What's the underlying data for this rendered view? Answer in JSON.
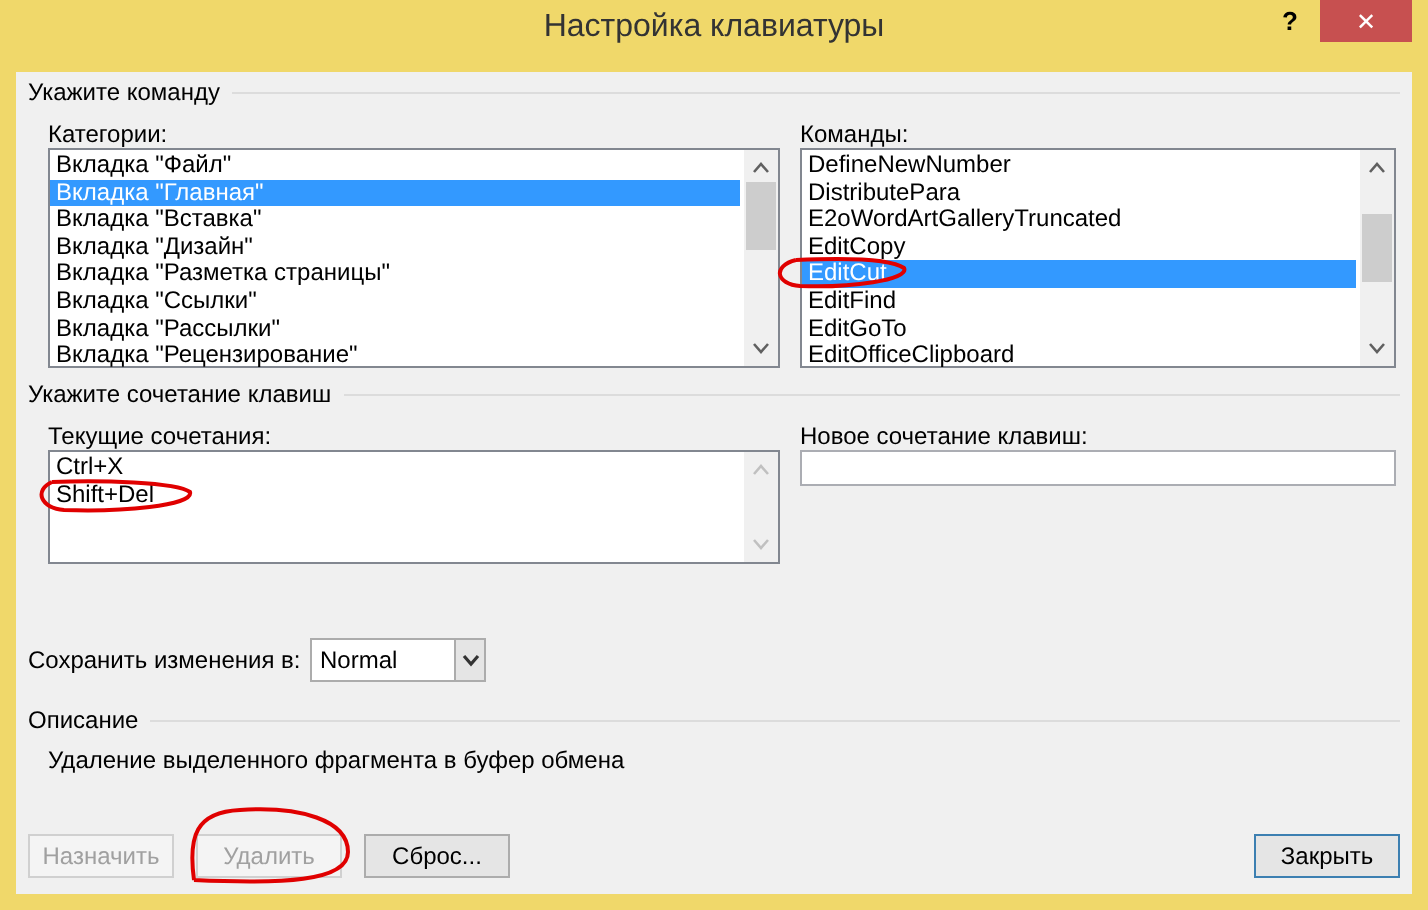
{
  "window": {
    "title": "Настройка клавиатуры",
    "help": "?",
    "close": "✕"
  },
  "command_group": {
    "title": "Укажите команду",
    "categories": {
      "label": "Категории:",
      "items": [
        {
          "text": "Вкладка \"Файл\"",
          "selected": false
        },
        {
          "text": "Вкладка \"Главная\"",
          "selected": true
        },
        {
          "text": "Вкладка \"Вставка\"",
          "selected": false
        },
        {
          "text": "Вкладка \"Дизайн\"",
          "selected": false
        },
        {
          "text": "Вкладка \"Разметка страницы\"",
          "selected": false
        },
        {
          "text": "Вкладка \"Ссылки\"",
          "selected": false
        },
        {
          "text": "Вкладка \"Рассылки\"",
          "selected": false
        },
        {
          "text": "Вкладка \"Рецензирование\"",
          "selected": false
        }
      ]
    },
    "commands": {
      "label": "Команды:",
      "items": [
        {
          "text": "DefineNewNumber",
          "selected": false
        },
        {
          "text": "DistributePara",
          "selected": false
        },
        {
          "text": "E2oWordArtGalleryTruncated",
          "selected": false
        },
        {
          "text": "EditCopy",
          "selected": false
        },
        {
          "text": "EditCut",
          "selected": true
        },
        {
          "text": "EditFind",
          "selected": false
        },
        {
          "text": "EditGoTo",
          "selected": false
        },
        {
          "text": "EditOfficeClipboard",
          "selected": false
        }
      ]
    }
  },
  "shortcut_group": {
    "title": "Укажите сочетание клавиш",
    "current": {
      "label": "Текущие сочетания:",
      "items": [
        {
          "text": "Ctrl+X",
          "selected": false
        },
        {
          "text": "Shift+Del",
          "selected": false
        }
      ]
    },
    "new": {
      "label": "Новое сочетание клавиш:"
    },
    "save_in": {
      "label": "Сохранить изменения в:",
      "value": "Normal"
    }
  },
  "description": {
    "title": "Описание",
    "text": "Удаление выделенного фрагмента в буфер обмена"
  },
  "buttons": [
    {
      "label": "Назначить",
      "disabled": true,
      "default": false
    },
    {
      "label": "Удалить",
      "disabled": true,
      "default": false
    },
    {
      "label": "Сброс...",
      "disabled": false,
      "default": false
    },
    {
      "label": "Закрыть",
      "disabled": false,
      "default": true
    }
  ]
}
